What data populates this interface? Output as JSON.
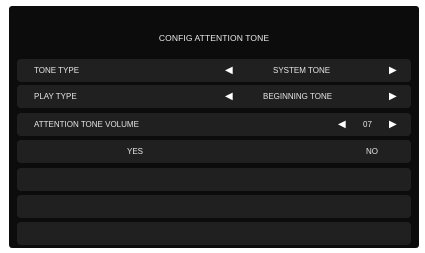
{
  "title": "CONFIG ATTENTION TONE",
  "rows": [
    {
      "label": "TONE TYPE",
      "value": "SYSTEM TONE"
    },
    {
      "label": "PLAY TYPE",
      "value": "BEGINNING TONE"
    },
    {
      "label": "ATTENTION TONE VOLUME",
      "value": "07"
    }
  ],
  "arrows": {
    "left": "◀",
    "right": "▶"
  },
  "buttons": {
    "yes": "YES",
    "no": "NO"
  },
  "colors": {
    "screen": "#0c0c0c",
    "row": "#202020",
    "text": "#e2e2e2"
  }
}
